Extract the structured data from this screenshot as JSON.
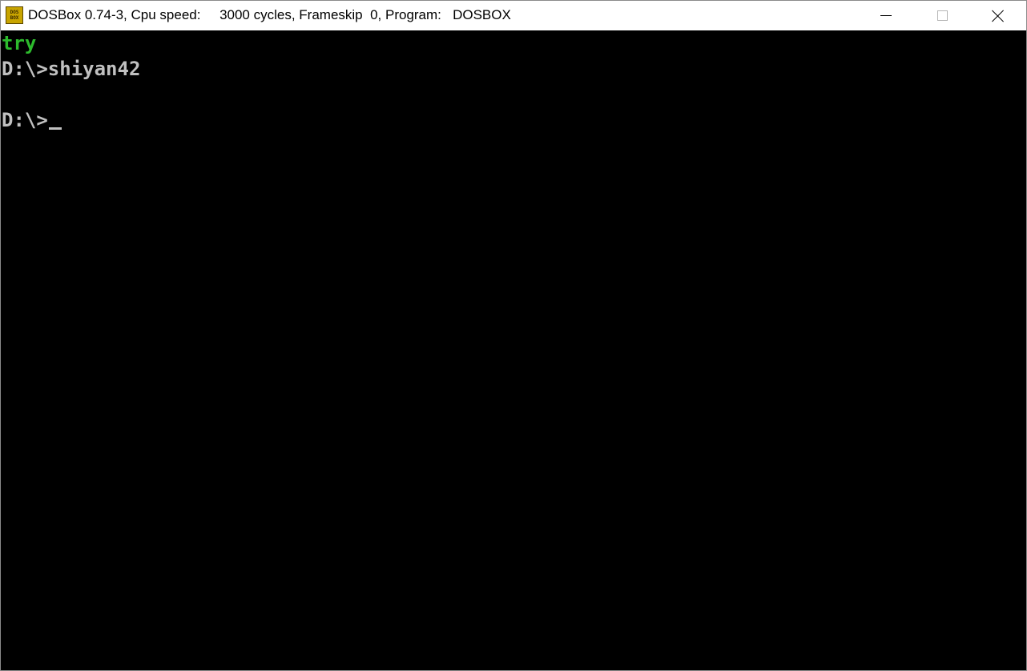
{
  "window": {
    "title": "DOSBox 0.74-3, Cpu speed:     3000 cycles, Frameskip  0, Program:   DOSBOX",
    "icon": "dosbox-icon",
    "icon_text_top": "DOS",
    "icon_text_bottom": "BOX",
    "buttons": {
      "minimize": "minimize-icon",
      "maximize": "maximize-icon",
      "close": "close-icon"
    }
  },
  "console": {
    "lines": [
      {
        "text": "try",
        "color": "#2dbb2d"
      },
      {
        "text": "D:\\>shiyan42",
        "color": "#c0c0c0"
      },
      {
        "text": "D:\\>",
        "color": "#c0c0c0"
      }
    ],
    "background": "#000000",
    "cursor": "_"
  }
}
